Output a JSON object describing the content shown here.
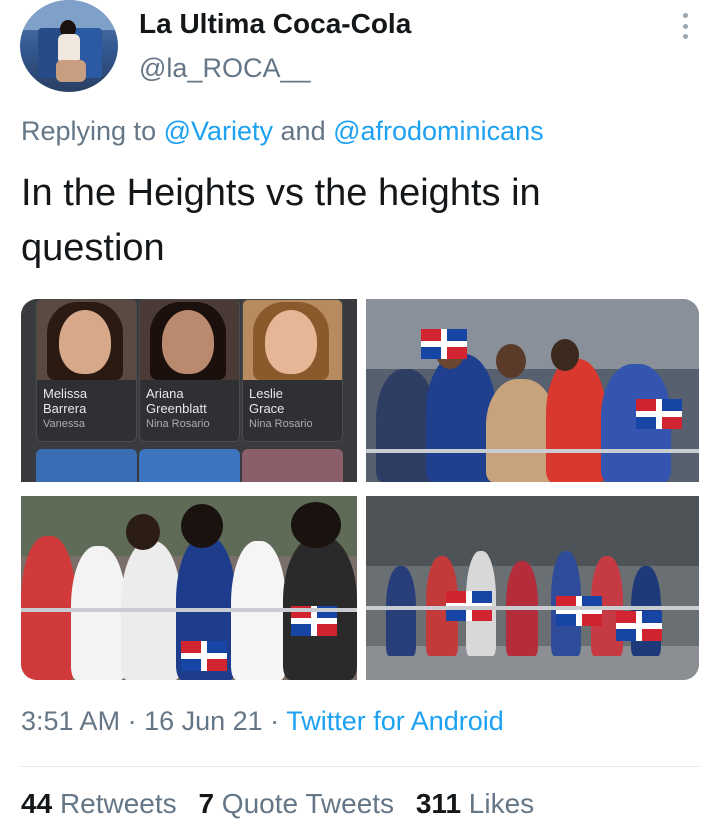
{
  "tweet": {
    "author": {
      "display_name": "La Ultima Coca-Cola",
      "handle": "@la_ROCA__"
    },
    "reply": {
      "prefix": "Replying to ",
      "mention_1": "@Variety",
      "joiner": " and ",
      "mention_2": "@afrodominicans"
    },
    "text": "In the Heights vs the heights in question",
    "media": {
      "cast_cards": [
        {
          "name_line1": "Melissa",
          "name_line2": "Barrera",
          "role": "Vanessa"
        },
        {
          "name_line1": "Ariana",
          "name_line2": "Greenblatt",
          "role": "Nina Rosario"
        },
        {
          "name_line1": "Leslie",
          "name_line2": "Grace",
          "role": "Nina Rosario"
        }
      ]
    },
    "meta": {
      "time": "3:51 AM",
      "sep": " · ",
      "date": "16 Jun 21",
      "sep2": " · ",
      "client": "Twitter for Android"
    },
    "stats": {
      "retweets_count": "44",
      "retweets_label": "Retweets",
      "quotes_count": "7",
      "quotes_label": "Quote Tweets",
      "likes_count": "311",
      "likes_label": "Likes"
    }
  },
  "colors": {
    "accent": "#1da1f2",
    "secondary_text": "#657786",
    "primary_text": "#14171a",
    "divider": "#e1e8ed"
  },
  "icons": {
    "more": "vertical-ellipsis-icon"
  }
}
